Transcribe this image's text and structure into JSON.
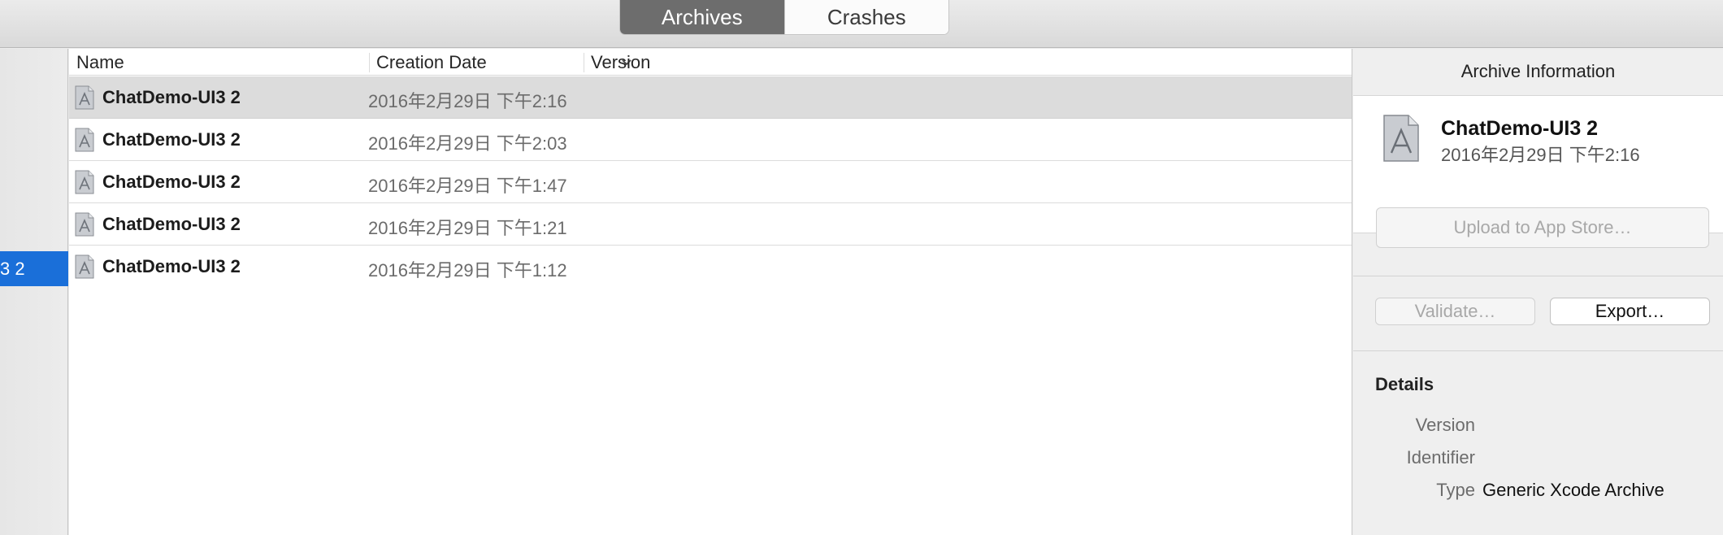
{
  "tabs": [
    {
      "label": "Archives",
      "active": true
    },
    {
      "label": "Crashes",
      "active": false
    }
  ],
  "sidebar": {
    "selected_item": "3 2"
  },
  "table": {
    "columns": [
      "Name",
      "Creation Date",
      "Version"
    ],
    "sort_column": "Creation Date",
    "rows": [
      {
        "name": "ChatDemo-UI3 2",
        "date": "2016年2月29日 下午2:16",
        "version": "",
        "selected": true
      },
      {
        "name": "ChatDemo-UI3 2",
        "date": "2016年2月29日 下午2:03",
        "version": "",
        "selected": false
      },
      {
        "name": "ChatDemo-UI3 2",
        "date": "2016年2月29日 下午1:47",
        "version": "",
        "selected": false
      },
      {
        "name": "ChatDemo-UI3 2",
        "date": "2016年2月29日 下午1:21",
        "version": "",
        "selected": false
      },
      {
        "name": "ChatDemo-UI3 2",
        "date": "2016年2月29日 下午1:12",
        "version": "",
        "selected": false
      }
    ]
  },
  "inspector": {
    "title": "Archive Information",
    "archive_name": "ChatDemo-UI3 2",
    "archive_date": "2016年2月29日 下午2:16",
    "upload_label": "Upload to App Store…",
    "validate_label": "Validate…",
    "export_label": "Export…",
    "details": {
      "heading": "Details",
      "version_label": "Version",
      "version_value": "",
      "identifier_label": "Identifier",
      "identifier_value": "",
      "type_label": "Type",
      "type_value": "Generic Xcode Archive"
    }
  },
  "icons": {
    "archive": "xcode-archive-icon",
    "sort": "chevron-down-icon"
  },
  "colors": {
    "selection_blue": "#1a6fd9",
    "segment_active": "#6d6d6d",
    "row_selected": "#dcdcdc"
  }
}
